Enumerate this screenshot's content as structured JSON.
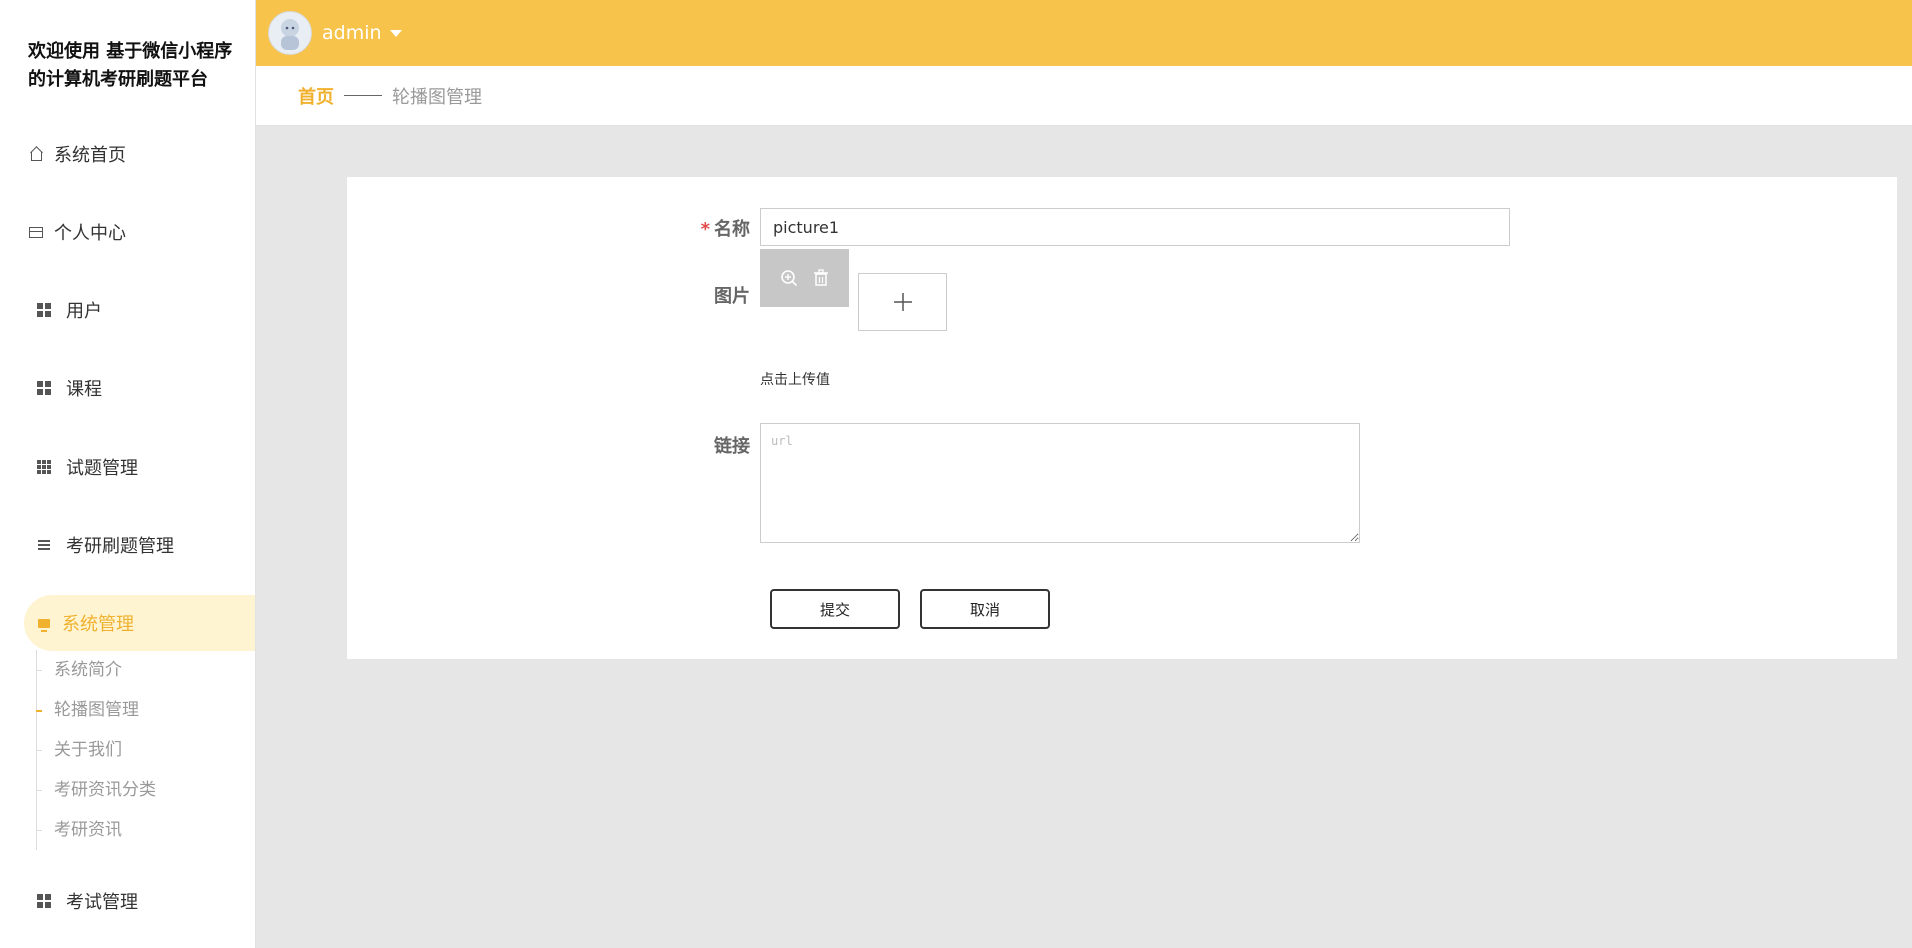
{
  "sidebar": {
    "brand": "欢迎使用 基于微信小程序的计算机考研刷题平台",
    "items": [
      {
        "label": "系统首页",
        "icon": "home-icon"
      },
      {
        "label": "个人中心",
        "icon": "wallet-icon"
      },
      {
        "label": "用户",
        "icon": "grid-icon"
      },
      {
        "label": "课程",
        "icon": "grid-icon"
      },
      {
        "label": "试题管理",
        "icon": "grid-9-icon"
      },
      {
        "label": "考研刷题管理",
        "icon": "list-icon"
      },
      {
        "label": "系统管理",
        "icon": "monitor-icon"
      },
      {
        "label": "考试管理",
        "icon": "grid-icon"
      }
    ],
    "submenu": [
      "系统简介",
      "轮播图管理",
      "关于我们",
      "考研资讯分类",
      "考研资讯"
    ]
  },
  "header": {
    "username": "admin"
  },
  "breadcrumb": {
    "home": "首页",
    "current": "轮播图管理"
  },
  "form": {
    "name_label": "名称",
    "name_value": "picture1",
    "image_label": "图片",
    "upload_hint": "点击上传值",
    "link_label": "链接",
    "link_placeholder": "url",
    "submit": "提交",
    "cancel": "取消"
  },
  "colors": {
    "accent": "#f7c34a",
    "active_text": "#f0b12f",
    "active_bg": "#fff4d1"
  }
}
